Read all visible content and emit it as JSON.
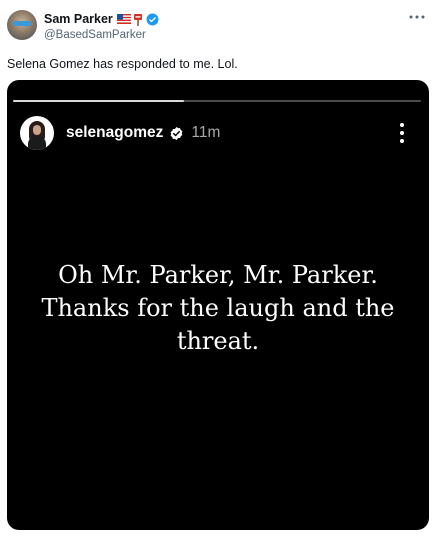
{
  "tweet": {
    "author": {
      "display_name": "Sam Parker",
      "handle": "@BasedSamParker",
      "avatar_icon": "profile-photo",
      "badges": [
        "us-flag-icon",
        "sign-icon",
        "verified-icon"
      ]
    },
    "text": "Selena Gomez has responded to me. Lol.",
    "more_icon": "more-dots-icon"
  },
  "story": {
    "progress": 0.42,
    "username": "selenagomez",
    "time": "11m",
    "verified": true,
    "lines": [
      "Oh Mr. Parker, Mr. Parker.",
      "Thanks for the laugh and the",
      "threat."
    ],
    "colors": {
      "background": "#000000",
      "text": "#ffffff",
      "time": "#a8a8a8"
    }
  },
  "colors": {
    "verified": "#1d9bf0",
    "handle": "#536471"
  }
}
